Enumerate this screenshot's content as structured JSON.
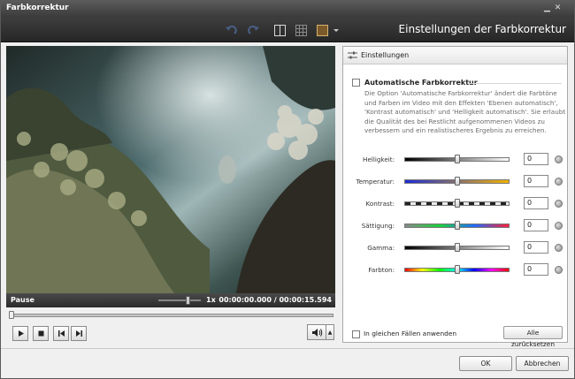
{
  "window": {
    "title": "Farbkorrektur"
  },
  "toolbar": {
    "heading": "Einstellungen der Farbkorrektur"
  },
  "player": {
    "state": "Pause",
    "speed": "1x",
    "time_current": "00:00:00.000",
    "time_separator": "/",
    "time_total": "00:00:15.594",
    "progress_fraction": 0.0
  },
  "panel": {
    "header": "Einstellungen",
    "auto_label": "Automatische Farbkorrektur",
    "auto_checked": false,
    "description": "Die Option 'Automatische Farbkorrektur' ändert die Farbtöne und Farben im Video mit den Effekten 'Ebenen automatisch', 'Kontrast automatisch' und 'Helligkeit automatisch'. Sie erlaubt die Qualität des bei Restlicht aufgenommenen Videos zu verbessern und ein realistischeres Ergebnis zu erreichen.",
    "sliders": [
      {
        "label": "Helligkeit:",
        "value": "0",
        "fraction": 0.5,
        "track": "linear-gradient(90deg,#000,#fff)"
      },
      {
        "label": "Temperatur:",
        "value": "0",
        "fraction": 0.5,
        "track": "linear-gradient(90deg,#1c2bd9,#f4b400)"
      },
      {
        "label": "Kontrast:",
        "value": "0",
        "fraction": 0.5,
        "track": "repeating-linear-gradient(90deg,#222 0 6px,#e8e8e8 6px 12px)"
      },
      {
        "label": "Sättigung:",
        "value": "0",
        "fraction": 0.5,
        "track": "linear-gradient(90deg,#888,#1dd13a,#1f6bff,#ff1f3a)"
      },
      {
        "label": "Gamma:",
        "value": "0",
        "fraction": 0.5,
        "track": "linear-gradient(90deg,#000,#fff)"
      },
      {
        "label": "Farbton:",
        "value": "0",
        "fraction": 0.5,
        "track": "linear-gradient(90deg,#f00,#ff0,#0f0,#0ff,#00f,#f0f,#f00)"
      }
    ],
    "same_cases_label": "In gleichen Fällen anwenden",
    "reset_all_label": "Alle zurücksetzen"
  },
  "buttons": {
    "ok": "OK",
    "cancel": "Abbrechen"
  },
  "icons": {
    "undo": "undo-icon",
    "redo": "redo-icon",
    "split-view": "split-view-icon",
    "grid-view": "grid-view-icon",
    "single-view": "single-view-icon",
    "play": "play-icon",
    "stop": "stop-icon",
    "prev-frame": "previous-frame-icon",
    "next-frame": "next-frame-icon",
    "volume": "speaker-icon",
    "settings": "sliders-icon"
  }
}
